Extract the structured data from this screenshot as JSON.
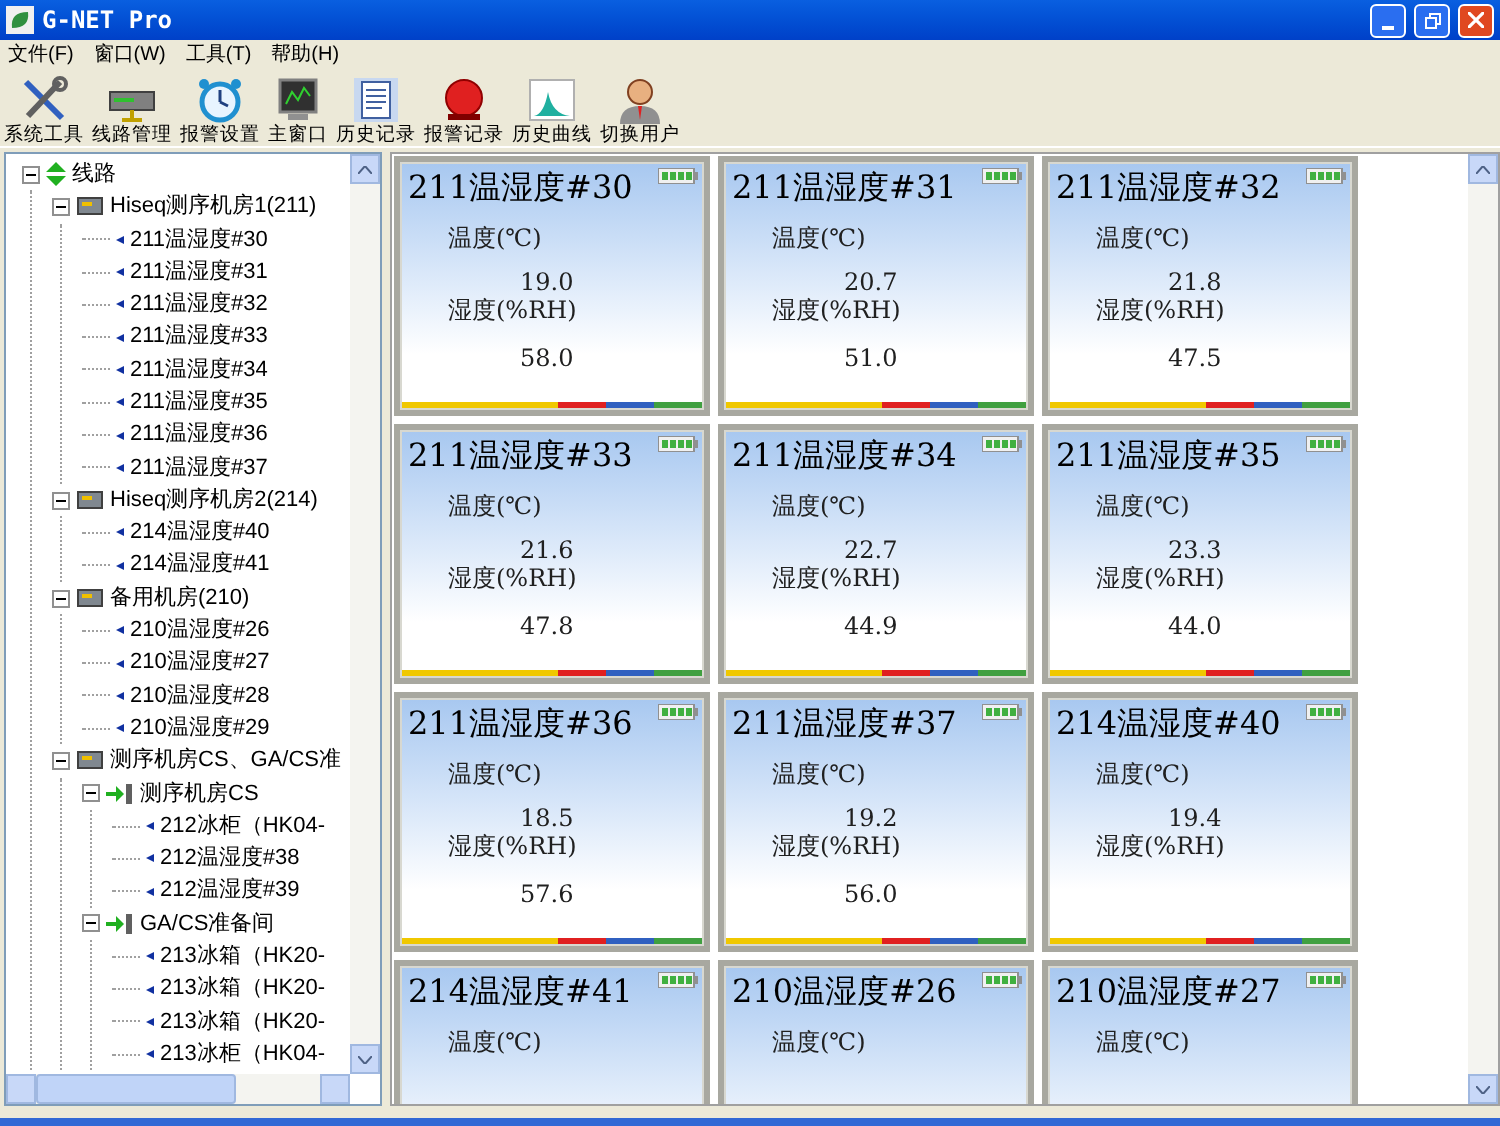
{
  "window": {
    "title": "G-NET Pro"
  },
  "menu": [
    "文件(F)",
    "窗口(W)",
    "工具(T)",
    "帮助(H)"
  ],
  "toolbar": [
    {
      "label": "系统工具",
      "kind": "tools"
    },
    {
      "label": "线路管理",
      "kind": "server"
    },
    {
      "label": "报警设置",
      "kind": "clock"
    },
    {
      "label": "主窗口",
      "kind": "monitor"
    },
    {
      "label": "历史记录",
      "kind": "document"
    },
    {
      "label": "报警记录",
      "kind": "bell"
    },
    {
      "label": "历史曲线",
      "kind": "chart"
    },
    {
      "label": "切换用户",
      "kind": "user"
    }
  ],
  "tree": [
    {
      "label": "线路",
      "kind": "root",
      "expanded": true,
      "children": [
        {
          "label": "Hiseq测序机房1(211)",
          "kind": "room",
          "expanded": true,
          "children": [
            {
              "label": "211温湿度#30",
              "kind": "sensor"
            },
            {
              "label": "211温湿度#31",
              "kind": "sensor"
            },
            {
              "label": "211温湿度#32",
              "kind": "sensor"
            },
            {
              "label": "211温湿度#33",
              "kind": "sensor"
            },
            {
              "label": "211温湿度#34",
              "kind": "sensor"
            },
            {
              "label": "211温湿度#35",
              "kind": "sensor"
            },
            {
              "label": "211温湿度#36",
              "kind": "sensor"
            },
            {
              "label": "211温湿度#37",
              "kind": "sensor"
            }
          ]
        },
        {
          "label": "Hiseq测序机房2(214)",
          "kind": "room",
          "expanded": true,
          "children": [
            {
              "label": "214温湿度#40",
              "kind": "sensor"
            },
            {
              "label": "214温湿度#41",
              "kind": "sensor"
            }
          ]
        },
        {
          "label": "备用机房(210)",
          "kind": "room",
          "expanded": true,
          "children": [
            {
              "label": "210温湿度#26",
              "kind": "sensor"
            },
            {
              "label": "210温湿度#27",
              "kind": "sensor"
            },
            {
              "label": "210温湿度#28",
              "kind": "sensor"
            },
            {
              "label": "210温湿度#29",
              "kind": "sensor"
            }
          ]
        },
        {
          "label": "测序机房CS、GA/CS准",
          "kind": "room",
          "expanded": true,
          "children": [
            {
              "label": "测序机房CS",
              "kind": "group",
              "expanded": true,
              "children": [
                {
                  "label": "212冰柜（HK04-",
                  "kind": "sensor"
                },
                {
                  "label": "212温湿度#38",
                  "kind": "sensor"
                },
                {
                  "label": "212温湿度#39",
                  "kind": "sensor"
                }
              ]
            },
            {
              "label": "GA/CS准备间",
              "kind": "group",
              "expanded": true,
              "children": [
                {
                  "label": "213冰箱（HK20-",
                  "kind": "sensor"
                },
                {
                  "label": "213冰箱（HK20-",
                  "kind": "sensor"
                },
                {
                  "label": "213冰箱（HK20-",
                  "kind": "sensor"
                },
                {
                  "label": "213冰柜（HK04-",
                  "kind": "sensor"
                }
              ]
            }
          ]
        }
      ]
    }
  ],
  "cards": [
    {
      "title": "211温湿度#30",
      "temp_label": "温度(℃)",
      "temp": "19.0",
      "hum_label": "湿度(%RH)",
      "hum": "58.0"
    },
    {
      "title": "211温湿度#31",
      "temp_label": "温度(℃)",
      "temp": "20.7",
      "hum_label": "湿度(%RH)",
      "hum": "51.0"
    },
    {
      "title": "211温湿度#32",
      "temp_label": "温度(℃)",
      "temp": "21.8",
      "hum_label": "湿度(%RH)",
      "hum": "47.5"
    },
    {
      "title": "211温湿度#33",
      "temp_label": "温度(℃)",
      "temp": "21.6",
      "hum_label": "湿度(%RH)",
      "hum": "47.8"
    },
    {
      "title": "211温湿度#34",
      "temp_label": "温度(℃)",
      "temp": "22.7",
      "hum_label": "湿度(%RH)",
      "hum": "44.9"
    },
    {
      "title": "211温湿度#35",
      "temp_label": "温度(℃)",
      "temp": "23.3",
      "hum_label": "湿度(%RH)",
      "hum": "44.0"
    },
    {
      "title": "211温湿度#36",
      "temp_label": "温度(℃)",
      "temp": "18.5",
      "hum_label": "湿度(%RH)",
      "hum": "57.6"
    },
    {
      "title": "211温湿度#37",
      "temp_label": "温度(℃)",
      "temp": "19.2",
      "hum_label": "湿度(%RH)",
      "hum": "56.0"
    },
    {
      "title": "214温湿度#40",
      "temp_label": "温度(℃)",
      "temp": "19.4",
      "hum_label": "湿度(%RH)"
    },
    {
      "title": "214温湿度#41",
      "temp_label": "温度(℃)"
    },
    {
      "title": "210温湿度#26",
      "temp_label": "温度(℃)"
    },
    {
      "title": "210温湿度#27",
      "temp_label": "温度(℃)"
    }
  ]
}
